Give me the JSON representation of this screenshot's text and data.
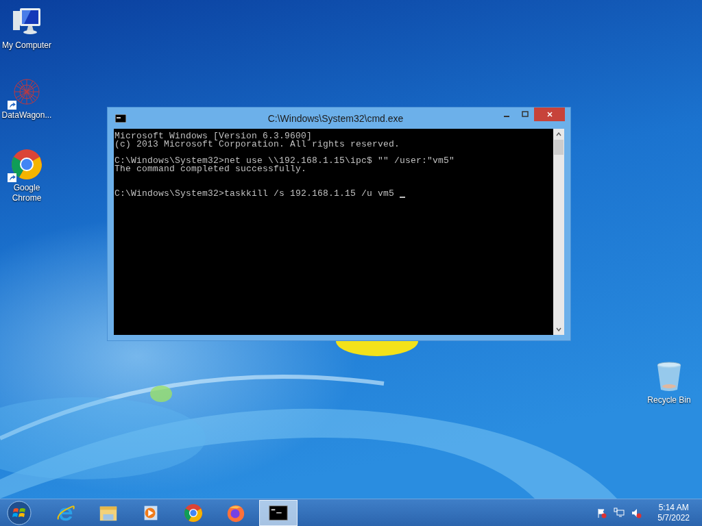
{
  "desktop_icons": [
    {
      "kind": "computer",
      "label": "My Computer",
      "shortcut": false
    },
    {
      "kind": "network",
      "label": "DataWagon...",
      "shortcut": true
    },
    {
      "kind": "chrome",
      "label": "Google Chrome",
      "shortcut": true
    },
    {
      "kind": "recycle",
      "label": "Recycle Bin",
      "shortcut": false
    }
  ],
  "window": {
    "title": "C:\\Windows\\System32\\cmd.exe",
    "lines": [
      {
        "kind": "line",
        "text": "Microsoft Windows [Version 6.3.9600]",
        "cursor": false
      },
      {
        "kind": "line",
        "text": "(c) 2013 Microsoft Corporation. All rights reserved.",
        "cursor": false
      },
      {
        "kind": "paragraph",
        "text": "C:\\Windows\\System32>net use \\\\192.168.1.15\\ipc$ \"\" /user:\"vm5\"",
        "cursor": false
      },
      {
        "kind": "line",
        "text": "The command completed successfully.",
        "cursor": false
      },
      {
        "kind": "section",
        "text": "C:\\Windows\\System32>taskkill /s 192.168.1.15 /u vm5",
        "cursor": true
      }
    ]
  },
  "taskbar": {
    "items": [
      {
        "kind": "ie",
        "selected": false
      },
      {
        "kind": "explorer",
        "selected": false
      },
      {
        "kind": "media",
        "selected": false
      },
      {
        "kind": "chrome",
        "selected": false
      },
      {
        "kind": "firefox",
        "selected": false
      },
      {
        "kind": "cmd",
        "selected": true
      }
    ],
    "clock": {
      "time": "5:14 AM",
      "date": "5/7/2022"
    }
  }
}
